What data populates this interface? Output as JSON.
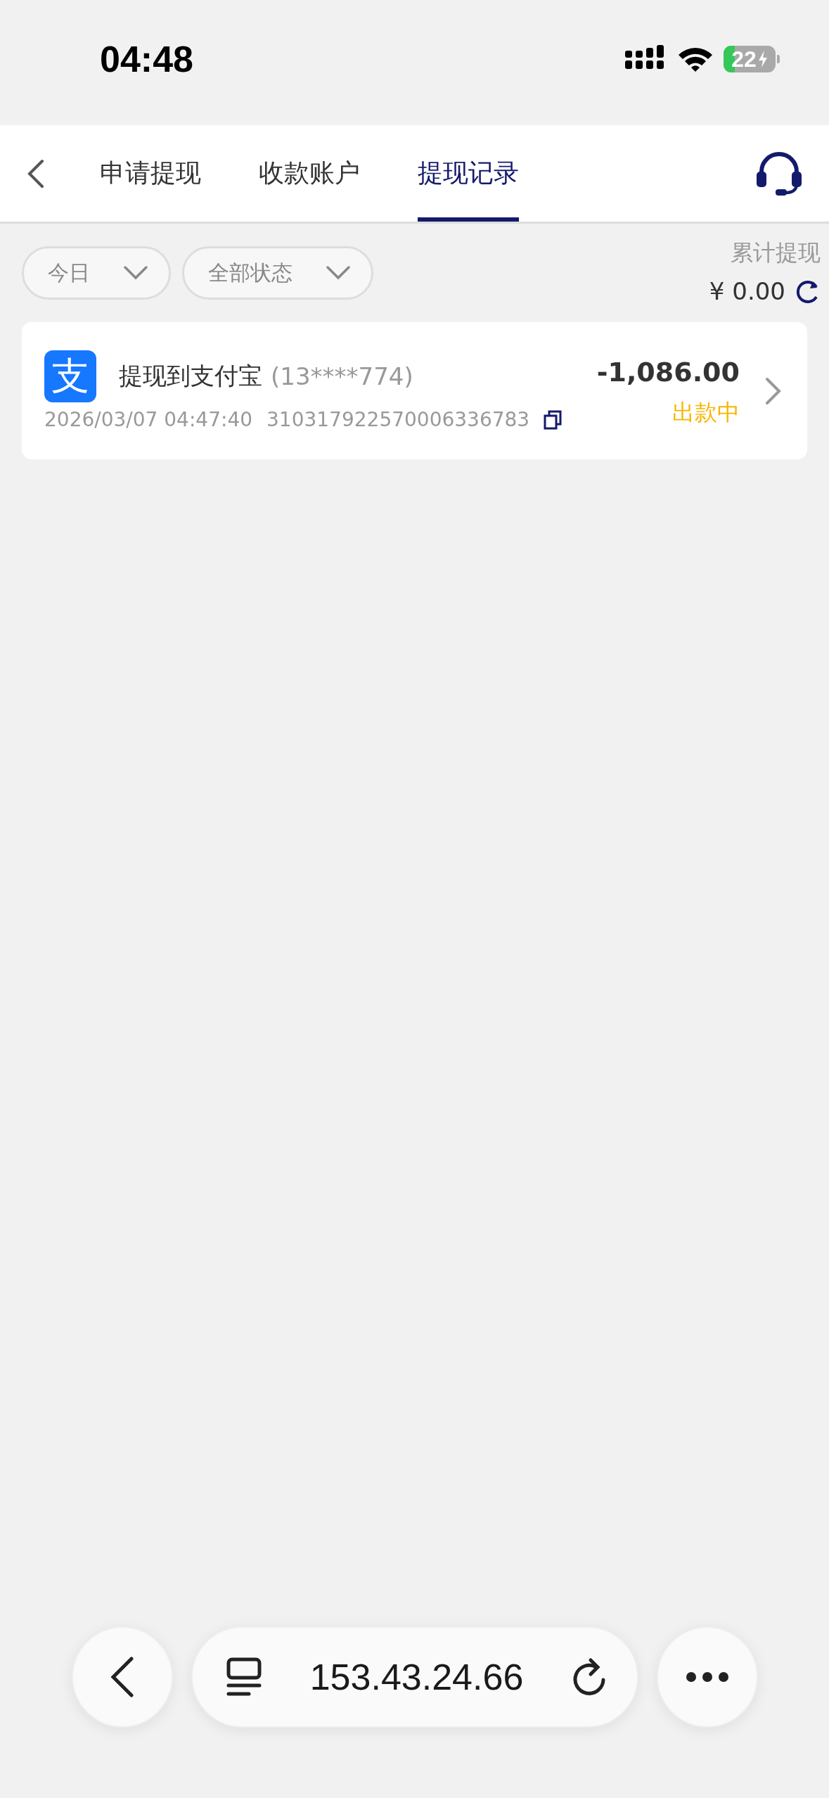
{
  "status_bar": {
    "time": "04:48",
    "battery": "22"
  },
  "nav": {
    "tabs": [
      {
        "label": "申请提现",
        "selected": false
      },
      {
        "label": "收款账户",
        "selected": false
      },
      {
        "label": "提现记录",
        "selected": true
      }
    ]
  },
  "filters": [
    {
      "label": "今日"
    },
    {
      "label": "全部状态"
    }
  ],
  "total": {
    "label": "累计提现",
    "amount": "¥ 0.00"
  },
  "records": [
    {
      "logo_text": "支",
      "title": "提现到支付宝",
      "account": "(13****774)",
      "datetime": "2026/03/07 04:47:40",
      "order_no": "310317922570006336783",
      "amount": "-1,086.00",
      "status": "出款中"
    }
  ],
  "browser_bar": {
    "url": "153.43.24.66"
  }
}
